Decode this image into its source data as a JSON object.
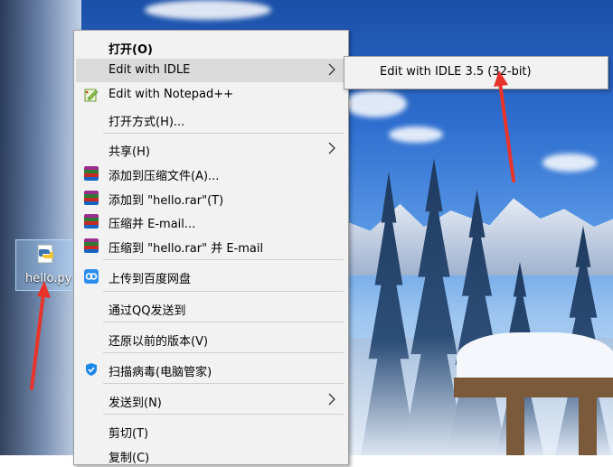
{
  "desktop": {
    "icon_label": "hello.py"
  },
  "context_menu": {
    "items": [
      {
        "label": "打开(O)",
        "icon": "none"
      },
      {
        "label": "Edit with IDLE",
        "icon": "none",
        "has_submenu": true
      },
      {
        "label": "Edit with Notepad++",
        "icon": "notepadpp-icon"
      },
      {
        "label": "打开方式(H)...",
        "icon": "none"
      },
      {
        "label": "共享(H)",
        "icon": "none",
        "has_submenu": true
      },
      {
        "label": "添加到压缩文件(A)...",
        "icon": "winrar-icon"
      },
      {
        "label": "添加到 \"hello.rar\"(T)",
        "icon": "winrar-icon"
      },
      {
        "label": "压缩并 E-mail...",
        "icon": "winrar-icon"
      },
      {
        "label": "压缩到 \"hello.rar\" 并 E-mail",
        "icon": "winrar-icon"
      },
      {
        "label": "上传到百度网盘",
        "icon": "baidu-netdisk-icon"
      },
      {
        "label": "通过QQ发送到",
        "icon": "none"
      },
      {
        "label": "还原以前的版本(V)",
        "icon": "none"
      },
      {
        "label": "扫描病毒(电脑管家)",
        "icon": "shield-icon"
      },
      {
        "label": "发送到(N)",
        "icon": "none",
        "has_submenu": true
      },
      {
        "label": "剪切(T)",
        "icon": "none"
      },
      {
        "label": "复制(C)",
        "icon": "none"
      }
    ]
  },
  "submenu": {
    "label": "Edit with IDLE 3.5 (32-bit)"
  },
  "colors": {
    "menu_bg": "#f2f2f2",
    "highlight": "#dadada",
    "annotation_arrow": "#e8342a"
  }
}
